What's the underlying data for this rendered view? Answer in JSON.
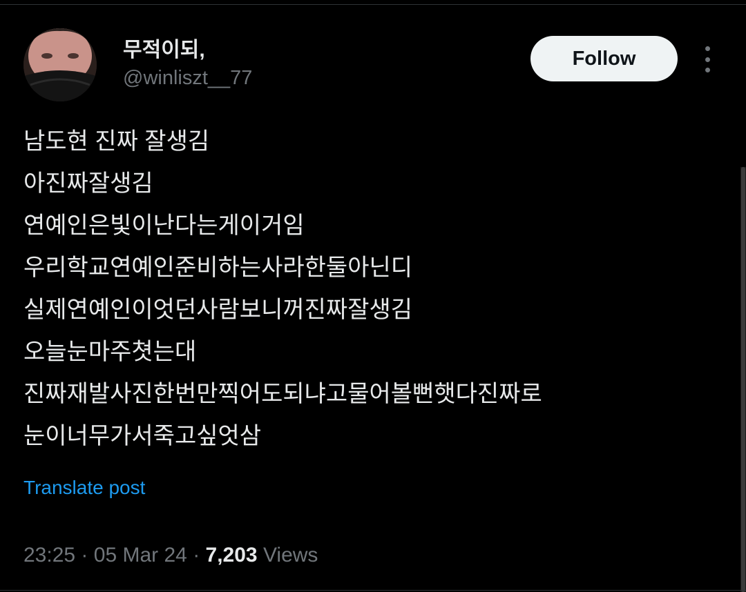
{
  "post": {
    "author": {
      "display_name": "무적이되,",
      "handle": "@winliszt__77",
      "avatar_icon": "profile-photo"
    },
    "follow_label": "Follow",
    "more_icon": "more-options-icon",
    "lines": [
      "남도현 진짜 잘생김",
      "아진짜잘생김",
      "연예인은빛이난다는게이거임",
      "우리학교연예인준비하는사라한둘아닌디",
      "실제연예인이엇던사람보니꺼진짜잘생김",
      "오늘눈마주쳣는대",
      "진짜재발사진한번만찍어도되냐고물어볼뻔햇다진짜로",
      "눈이너무가서죽고싶엇삼"
    ],
    "translate_label": "Translate post",
    "time": "23:25",
    "separator": "·",
    "date": "05 Mar 24",
    "views_count": "7,203",
    "views_label": "Views"
  },
  "colors": {
    "background": "#000000",
    "text_primary": "#e7e9ea",
    "text_secondary": "#71767b",
    "link": "#1d9bf0",
    "follow_bg": "#eff3f4",
    "follow_text": "#0f1419"
  }
}
